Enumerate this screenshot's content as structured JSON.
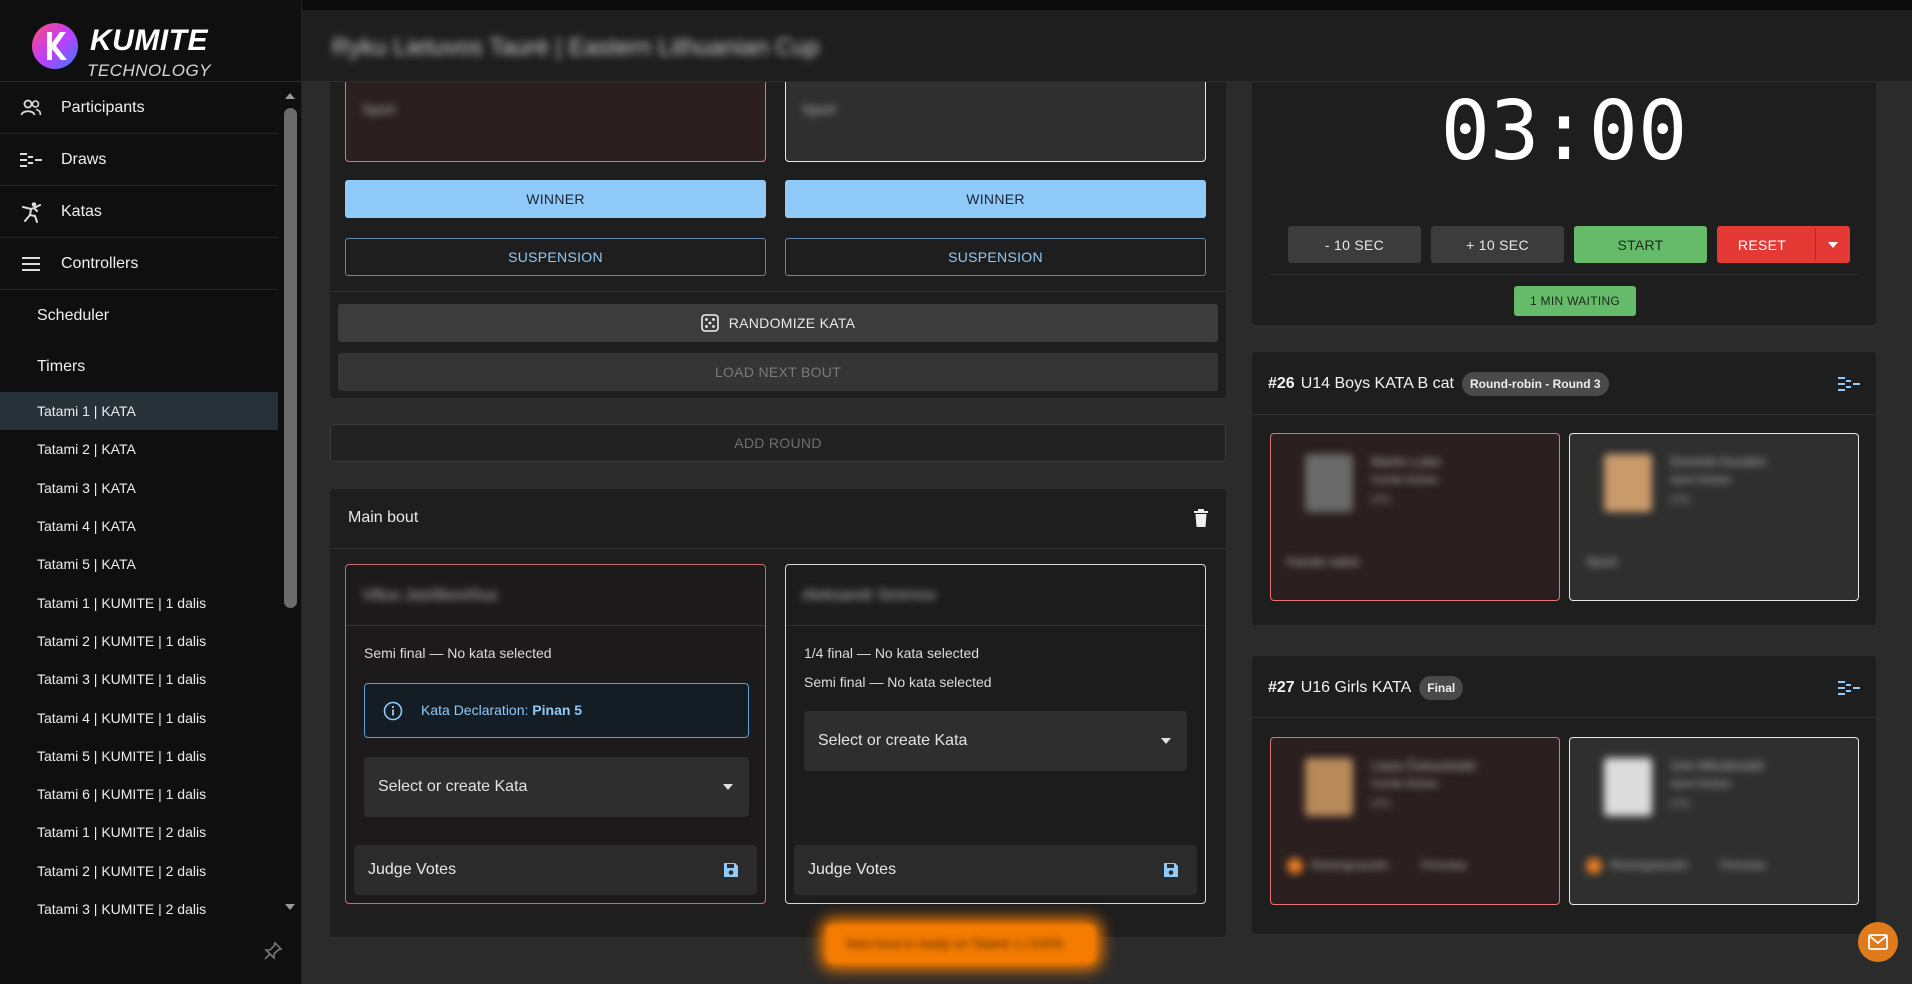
{
  "brand": {
    "title": "KUMITE",
    "subtitle": "TECHNOLOGY"
  },
  "header": {
    "title": "Ryku Lietuvos Taurė | Eastern Lithuanian Cup"
  },
  "sidebar": {
    "items": [
      {
        "label": "Participants",
        "icon": "people-icon"
      },
      {
        "label": "Draws",
        "icon": "draws-icon"
      },
      {
        "label": "Katas",
        "icon": "kata-icon"
      },
      {
        "label": "Controllers",
        "icon": "menu-icon"
      }
    ],
    "subitems": [
      "Scheduler",
      "Timers"
    ],
    "tatamis": [
      "Tatami 1 | KATA",
      "Tatami 2 | KATA",
      "Tatami 3 | KATA",
      "Tatami 4 | KATA",
      "Tatami 5 | KATA",
      "Tatami 1 | KUMITE | 1 dalis",
      "Tatami 2 | KUMITE | 1 dalis",
      "Tatami 3 | KUMITE | 1 dalis",
      "Tatami 4 | KUMITE | 1 dalis",
      "Tatami 5 | KUMITE | 1 dalis",
      "Tatami 6 | KUMITE | 1 dalis",
      "Tatami 1 | KUMITE | 2 dalis",
      "Tatami 2 | KUMITE | 2 dalis",
      "Tatami 3 | KUMITE | 2 dalis"
    ],
    "active": "Tatami 1 | KATA"
  },
  "top_bout": {
    "aka_text": "Sport",
    "shiro_text": "Sport",
    "winner_label": "WINNER",
    "suspension_label": "SUSPENSION",
    "randomize_label": "RANDOMIZE KATA",
    "load_next_label": "LOAD NEXT BOUT"
  },
  "add_round_label": "ADD ROUND",
  "main_bout": {
    "title": "Main bout",
    "aka": {
      "name": "Vilius Jasiškevičius",
      "rounds": [
        "Semi final — No kata selected"
      ],
      "declaration_prefix": "Kata Declaration: ",
      "declaration_value": "Pinan 5",
      "select_placeholder": "Select or create Kata",
      "judge_label": "Judge Votes"
    },
    "shiro": {
      "name": "Aleksandr Smirnov",
      "rounds": [
        "1/4 final — No kata selected",
        "Semi final — No kata selected"
      ],
      "select_placeholder": "Select or create Kata",
      "judge_label": "Judge Votes"
    }
  },
  "timer": {
    "display": "03:00",
    "minus_label": "- 10 SEC",
    "plus_label": "+ 10 SEC",
    "start_label": "START",
    "reset_label": "RESET",
    "waiting_label": "1 MIN WAITING"
  },
  "bout_26": {
    "number": "#26",
    "title": "U14 Boys KATA B cat",
    "badge": "Round-robin - Round 3",
    "aka": {
      "name": "Martin Lukis",
      "club": "Karate klubas",
      "country": "LTU",
      "footer": "Karate sakai"
    },
    "shiro": {
      "name": "Dominik Kovalev",
      "club": "Sport klubas",
      "country": "LTU",
      "footer": "Sport"
    }
  },
  "bout_27": {
    "number": "#27",
    "title": "U16 Girls KATA",
    "badge": "Final",
    "aka": {
      "name": "Liepa Žukauskaitė",
      "club": "Karate klubas",
      "country": "LTU",
      "status1": "Reisingnacelin",
      "status2": "Firmulas"
    },
    "shiro": {
      "name": "Urte Mikulėnaitė",
      "club": "Sport klubas",
      "country": "LTU",
      "status1": "Reisingnacelin",
      "status2": "Firmulas"
    }
  },
  "toast": {
    "text": "New bout is ready on Tatami 1 | KATA"
  },
  "colors": {
    "accent": "#90caf9",
    "aka": "#e57373",
    "start": "#66bb6a",
    "reset": "#e53935",
    "fab": "#e07a1a"
  }
}
